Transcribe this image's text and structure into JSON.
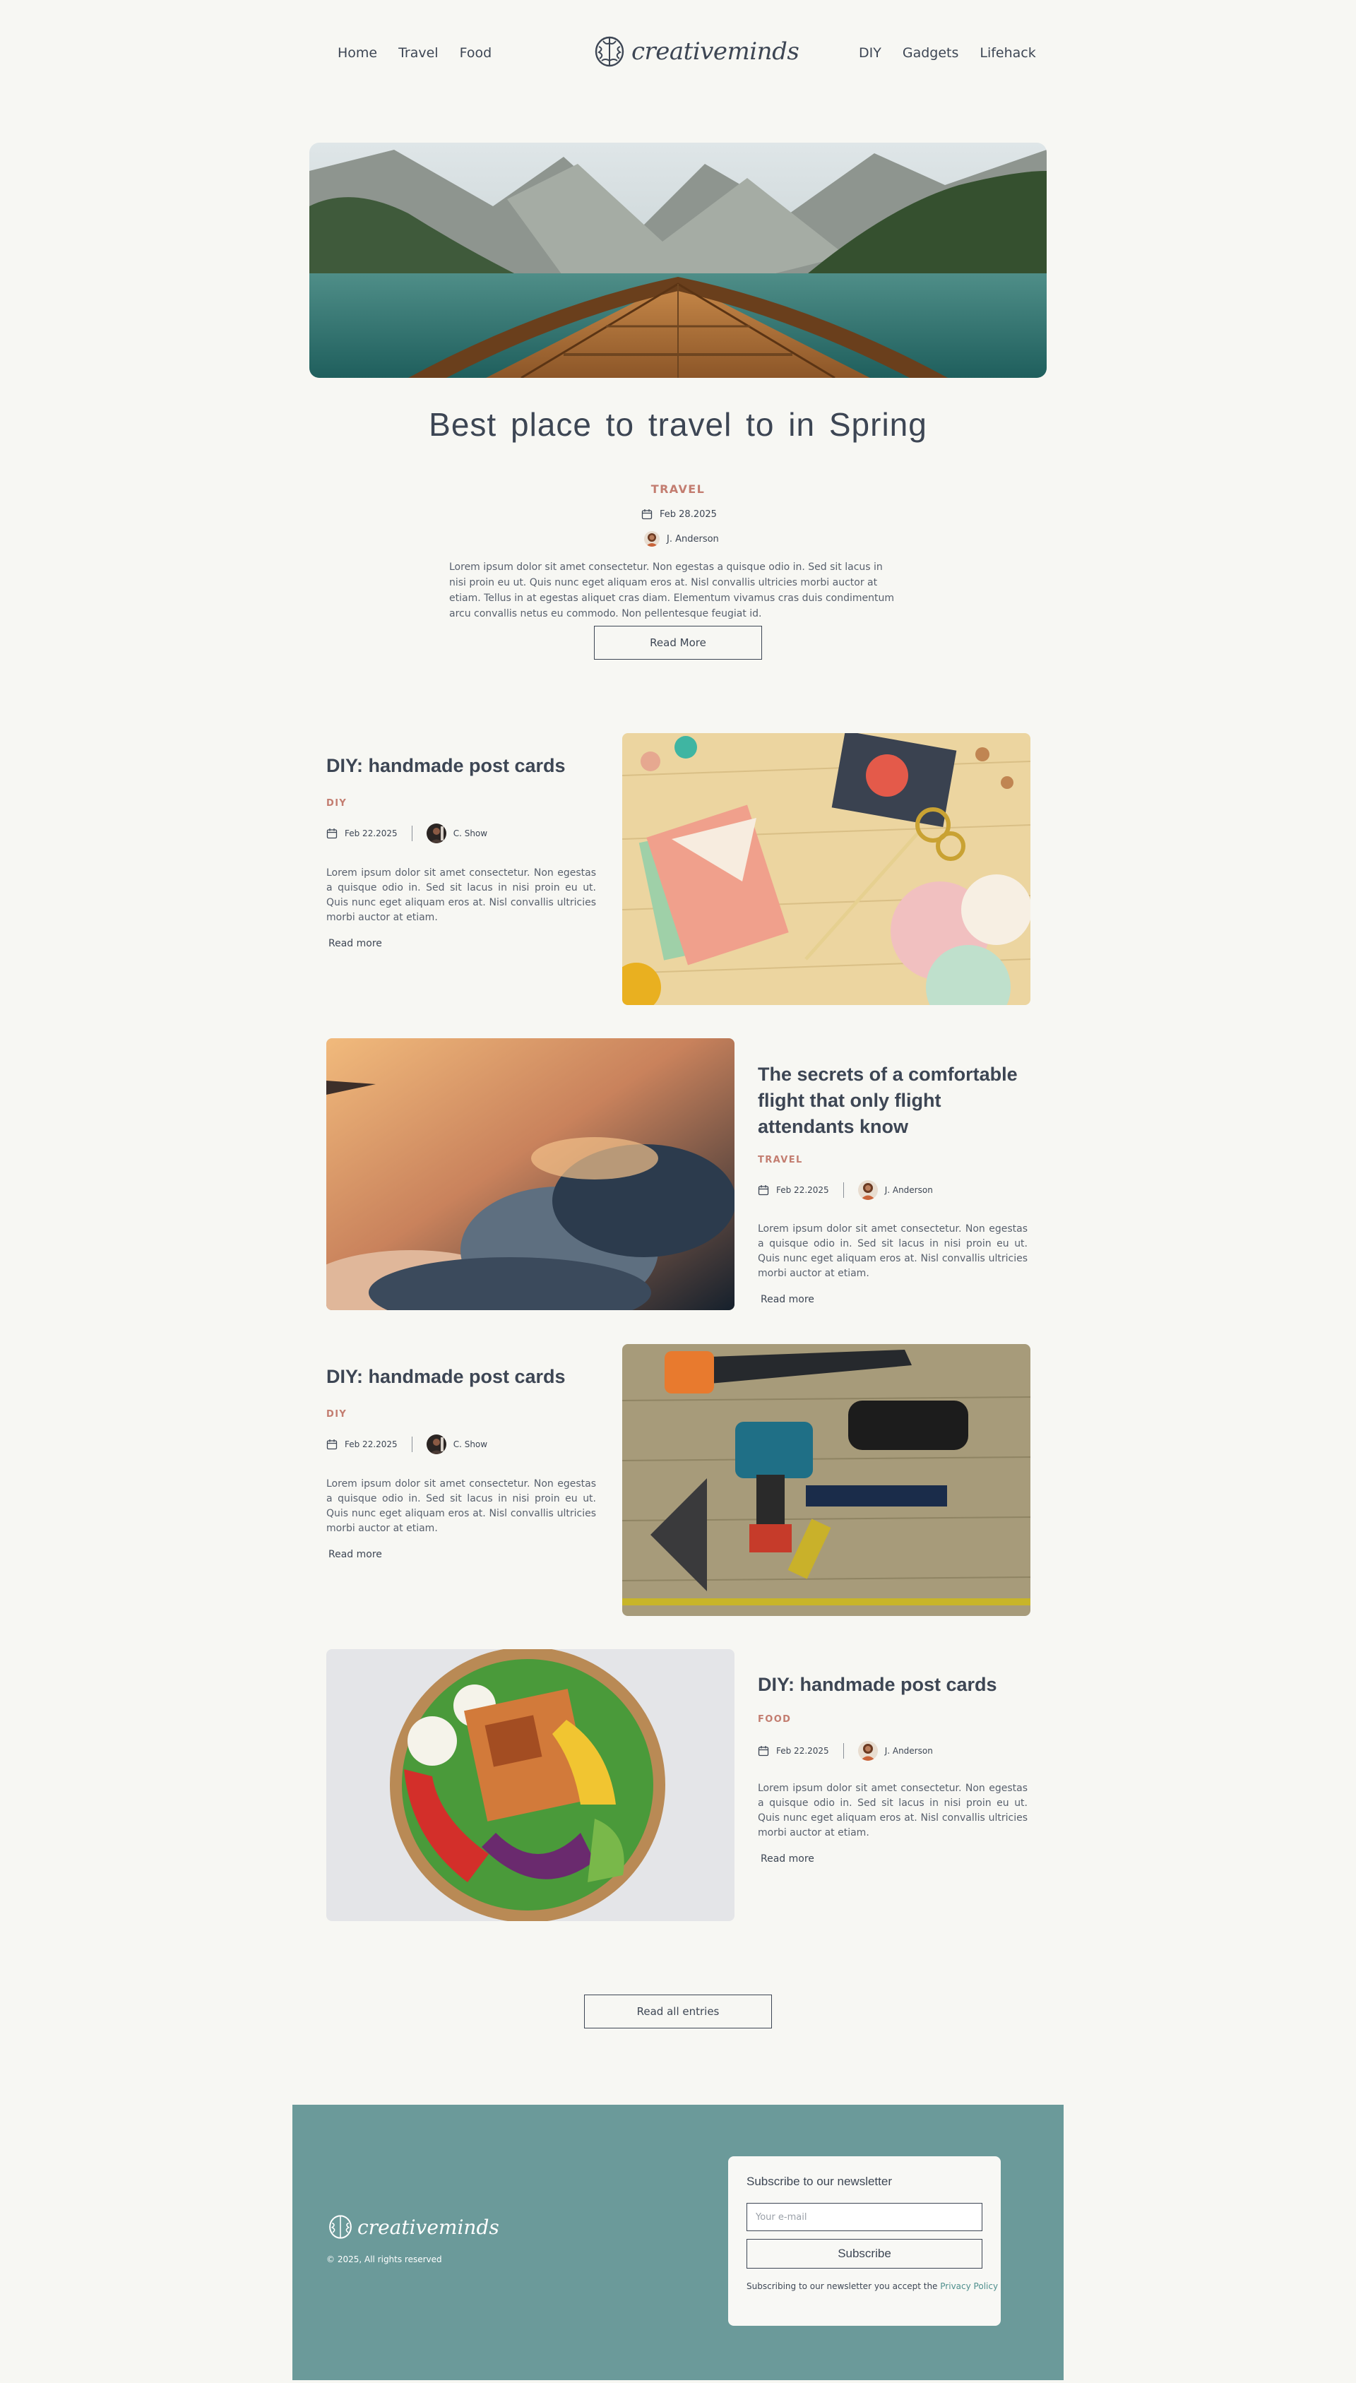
{
  "nav": {
    "left": [
      "Home",
      "Travel",
      "Food"
    ],
    "right": [
      "DIY",
      "Gadgets",
      "Lifehack"
    ],
    "brand": "creativeminds"
  },
  "hero": {
    "title": "Best place to travel to in Spring",
    "category": "TRAVEL",
    "date": "Feb 28.2025",
    "author": "J. Anderson",
    "excerpt": "Lorem ipsum dolor sit amet consectetur. Non egestas a quisque odio in. Sed sit lacus in nisi proin eu ut. Quis nunc eget aliquam eros at. Nisl convallis ultricies morbi auctor at etiam. Tellus in at egestas aliquet cras diam. Elementum vivamus cras duis condimentum arcu convallis netus eu commodo. Non pellentesque feugiat id.",
    "button": "Read More"
  },
  "articles": [
    {
      "title": "DIY: handmade post cards",
      "category": "DIY",
      "date": "Feb 22.2025",
      "author": "C. Show",
      "excerpt": "Lorem ipsum dolor sit amet consectetur. Non egestas a quisque odio in. Sed sit lacus in nisi proin eu ut. Quis nunc eget aliquam eros at. Nisl convallis ultricies morbi auctor at etiam.",
      "more": "Read more"
    },
    {
      "title": "The secrets of a comfortable flight that only flight attendants know",
      "category": "TRAVEL",
      "date": "Feb 22.2025",
      "author": "J. Anderson",
      "excerpt": "Lorem ipsum dolor sit amet consectetur. Non egestas a quisque odio in. Sed sit lacus in nisi proin eu ut. Quis nunc eget aliquam eros at. Nisl convallis ultricies morbi auctor at etiam.",
      "more": "Read more"
    },
    {
      "title": "DIY: handmade post cards",
      "category": "DIY",
      "date": "Feb 22.2025",
      "author": "C. Show",
      "excerpt": "Lorem ipsum dolor sit amet consectetur. Non egestas a quisque odio in. Sed sit lacus in nisi proin eu ut. Quis nunc eget aliquam eros at. Nisl convallis ultricies morbi auctor at etiam.",
      "more": "Read more"
    },
    {
      "title": "DIY: handmade post cards",
      "category": "FOOD",
      "date": "Feb 22.2025",
      "author": "J. Anderson",
      "excerpt": "Lorem ipsum dolor sit amet consectetur. Non egestas a quisque odio in. Sed sit lacus in nisi proin eu ut. Quis nunc eget aliquam eros at. Nisl convallis ultricies morbi auctor at etiam.",
      "more": "Read more"
    }
  ],
  "read_all": "Read all entries",
  "footer": {
    "brand": "creativeminds",
    "copyright": "© 2025, All rights reserved",
    "newsletter": {
      "title": "Subscribe to our newsletter",
      "placeholder": "Your e-mail",
      "button": "Subscribe",
      "note": "Subscribing to our newsletter you accept the",
      "link": "Privacy Policy"
    }
  },
  "colors": {
    "background": "#f7f7f3",
    "accent": "#c37d70",
    "footer": "#6b9a9a",
    "text": "#3d4654"
  },
  "icons": [
    "brain-logo-icon",
    "calendar-icon"
  ]
}
